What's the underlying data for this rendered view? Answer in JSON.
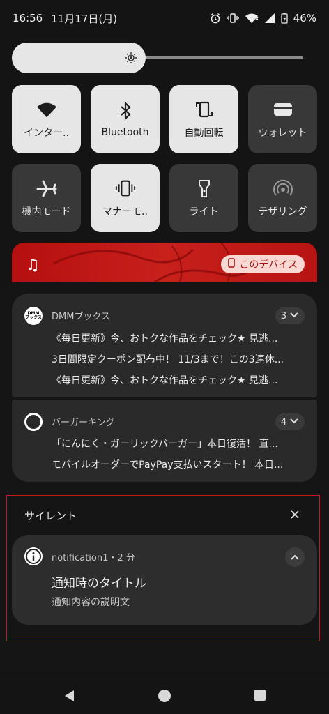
{
  "status_bar": {
    "time": "16:56",
    "date": "11月17日(月)",
    "battery": "46%",
    "icons": [
      "alarm-icon",
      "vibrate-icon",
      "wifi-icon",
      "signal-icon",
      "battery-icon"
    ]
  },
  "brightness": {
    "level": 0.46
  },
  "tiles": [
    {
      "label": "インター..",
      "icon": "wifi-icon",
      "on": true
    },
    {
      "label": "Bluetooth",
      "icon": "bluetooth-icon",
      "on": true
    },
    {
      "label": "自動回転",
      "icon": "auto-rotate-icon",
      "on": true
    },
    {
      "label": "ウォレット",
      "icon": "wallet-icon",
      "on": false
    },
    {
      "label": "機内モード",
      "icon": "airplane-icon",
      "on": false
    },
    {
      "label": "マナーモ..",
      "icon": "vibrate-icon",
      "on": true
    },
    {
      "label": "ライト",
      "icon": "flashlight-icon",
      "on": false
    },
    {
      "label": "テザリング",
      "icon": "hotspot-icon",
      "on": false
    }
  ],
  "media": {
    "output_label": "このデバイス",
    "icon": "music-note-icon",
    "accent": "#b81414"
  },
  "notifications": [
    {
      "app": "DMMブックス",
      "icon_text": "DMM\nブックス",
      "count": "3",
      "messages": [
        "《毎日更新》今、おトクな作品をチェック★ 見逃...",
        "3日間限定クーポン配布中！ 11/3まで！この3連休...",
        "《毎日更新》今、おトクな作品をチェック★ 見逃..."
      ]
    },
    {
      "app": "バーガーキング",
      "count": "4",
      "messages": [
        "「にんにく・ガーリックバーガー」本日復活！ 直...",
        "モバイルオーダーでPayPay支払いスタート！ 本日..."
      ]
    }
  ],
  "silent": {
    "header": "サイレント",
    "notification": {
      "meta": "notification1・2 分",
      "title": "通知時のタイトル",
      "body": "通知内容の説明文"
    },
    "highlight_color": "#c4161c"
  },
  "navbar": {
    "buttons": [
      "back-icon",
      "home-icon",
      "recents-icon"
    ]
  }
}
